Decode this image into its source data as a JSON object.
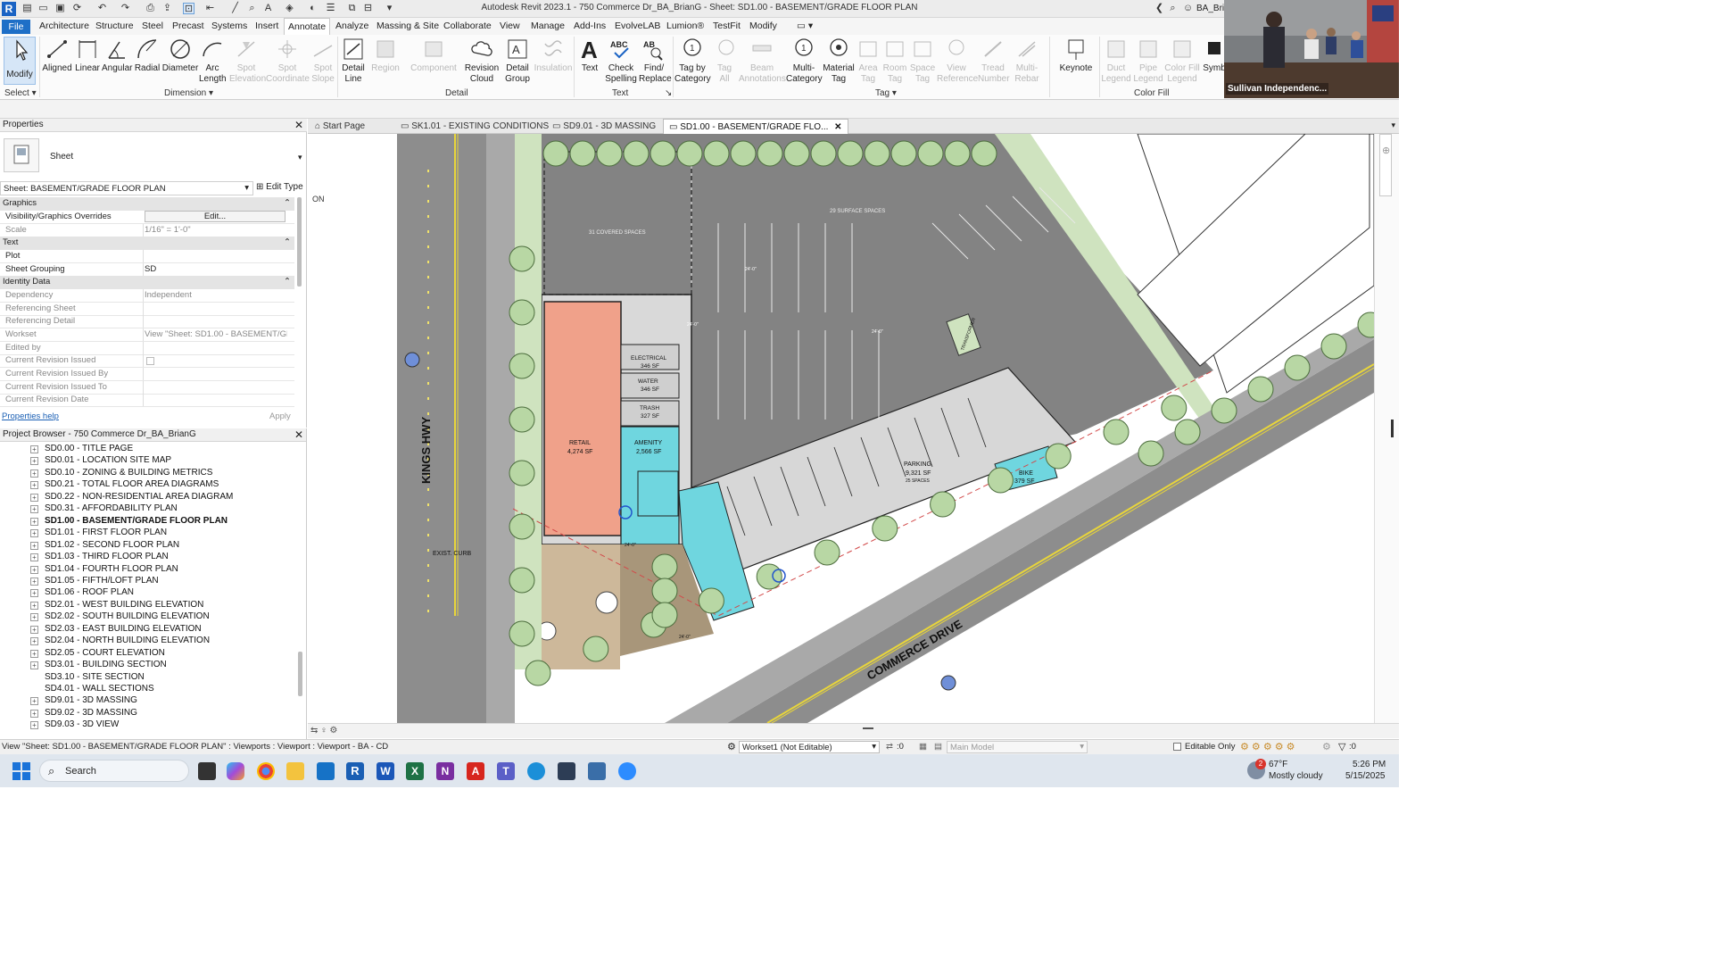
{
  "window": {
    "title": "Autodesk Revit 2023.1 - 750 Commerce Dr_BA_BrianG - Sheet: SD1.00 - BASEMENT/GRADE FLOOR PLAN",
    "user": "BA_Bria"
  },
  "menu_tabs": [
    "File",
    "Architecture",
    "Structure",
    "Steel",
    "Precast",
    "Systems",
    "Insert",
    "Annotate",
    "Analyze",
    "Massing & Site",
    "Collaborate",
    "View",
    "Manage",
    "Add-Ins",
    "EvolveLAB",
    "Lumion®",
    "TestFit",
    "Modify"
  ],
  "active_tab": "Annotate",
  "ribbon": {
    "modify": "Modify",
    "select": "Select",
    "dimension_tools": [
      "Aligned",
      "Linear",
      "Angular",
      "Radial",
      "Diameter",
      "Arc Length",
      "Spot Elevation",
      "Spot Coordinate",
      "Spot Slope"
    ],
    "dimension_group": "Dimension",
    "detail_tools": [
      "Detail Line",
      "Region",
      "Component",
      "Revision Cloud",
      "Detail Group",
      "Insulation"
    ],
    "detail_group": "Detail",
    "text_tools": [
      "Text",
      "Check Spelling",
      "Find/ Replace"
    ],
    "text_group": "Text",
    "tag_tools": [
      "Tag by Category",
      "Tag All",
      "Beam Annotations",
      "Multi- Category",
      "Material Tag",
      "Area Tag",
      "Room Tag",
      "Space Tag",
      "View Reference",
      "Tread Number",
      "Multi- Rebar"
    ],
    "tag_group": "Tag",
    "keynote": "Keynote",
    "color_fill_tools": [
      "Duct Legend",
      "Pipe Legend",
      "Color Fill Legend",
      "Symb"
    ],
    "color_fill_group": "Color Fill"
  },
  "video_caption": "Sullivan Independenc...",
  "properties": {
    "title": "Properties",
    "type_name": "Sheet",
    "selector": "Sheet: BASEMENT/GRADE FLOOR PLAN",
    "edit_type": "Edit Type",
    "categories": {
      "graphics": "Graphics",
      "text": "Text",
      "identity": "Identity Data"
    },
    "rows": [
      {
        "k": "Visibility/Graphics Overrides",
        "v": "Edit..."
      },
      {
        "k": "Scale",
        "v": "1/16\" = 1'-0\""
      },
      {
        "k": "Plot",
        "v": ""
      },
      {
        "k": "Sheet Grouping",
        "v": "SD"
      },
      {
        "k": "Dependency",
        "v": "Independent"
      },
      {
        "k": "Referencing Sheet",
        "v": ""
      },
      {
        "k": "Referencing Detail",
        "v": ""
      },
      {
        "k": "Workset",
        "v": "View \"Sheet: SD1.00 - BASEMENT/GR..."
      },
      {
        "k": "Edited by",
        "v": ""
      },
      {
        "k": "Current Revision Issued",
        "v": ""
      },
      {
        "k": "Current Revision Issued By",
        "v": ""
      },
      {
        "k": "Current Revision Issued To",
        "v": ""
      },
      {
        "k": "Current Revision Date",
        "v": ""
      }
    ],
    "help": "Properties help",
    "apply": "Apply"
  },
  "browser": {
    "title": "Project Browser - 750 Commerce Dr_BA_BrianG",
    "items": [
      "SD0.00 - TITLE PAGE",
      "SD0.01 - LOCATION SITE MAP",
      "SD0.10 - ZONING & BUILDING METRICS",
      "SD0.21 - TOTAL FLOOR AREA DIAGRAMS",
      "SD0.22 - NON-RESIDENTIAL AREA DIAGRAM",
      "SD0.31 - AFFORDABILITY PLAN",
      "SD1.00 - BASEMENT/GRADE FLOOR PLAN",
      "SD1.01 - FIRST FLOOR PLAN",
      "SD1.02 - SECOND FLOOR PLAN",
      "SD1.03 - THIRD FLOOR PLAN",
      "SD1.04 - FOURTH FLOOR PLAN",
      "SD1.05 - FIFTH/LOFT PLAN",
      "SD1.06 - ROOF PLAN",
      "SD2.01 - WEST BUILDING ELEVATION",
      "SD2.02 - SOUTH BUILDING ELEVATION",
      "SD2.03 - EAST BUILDING ELEVATION",
      "SD2.04 - NORTH BUILDING ELEVATION",
      "SD2.05 - COURT ELEVATION",
      "SD3.01 - BUILDING SECTION",
      "SD3.10 - SITE SECTION",
      "SD4.01 - WALL SECTIONS",
      "SD9.01 - 3D MASSING",
      "SD9.02 - 3D MASSING",
      "SD9.03 - 3D VIEW"
    ]
  },
  "view_tabs": [
    "Start Page",
    "SK1.01 - EXISTING CONDITIONS",
    "SD9.01 - 3D MASSING",
    "SD1.00 - BASEMENT/GRADE FLO..."
  ],
  "plan": {
    "street_west": "KINGS HWY",
    "street_south": "COMMERCE DRIVE",
    "exist_curb": "EXIST. CURB",
    "covered_spaces": "31 COVERED SPACES",
    "surface_spaces": "29 SURFACE SPACES",
    "rooms": [
      {
        "name": "RETAIL",
        "area": "4,274 SF"
      },
      {
        "name": "ELECTRICAL",
        "area": "346 SF"
      },
      {
        "name": "WATER",
        "area": "346 SF"
      },
      {
        "name": "TRASH",
        "area": "327 SF"
      },
      {
        "name": "AMENITY",
        "area": "2,566 SF"
      },
      {
        "name": "PARKING",
        "area": "9,321 SF",
        "extra": "25 SPACES"
      },
      {
        "name": "BIKE",
        "area": "379 SF"
      }
    ],
    "transformer": "TRANSFORMER",
    "side_mark": "ON",
    "dims": [
      "24'-0\"",
      "24'-0\"",
      "24'-0\"",
      "24'-0\"",
      "24'-0\""
    ]
  },
  "status": {
    "left": "View \"Sheet: SD1.00 - BASEMENT/GRADE FLOOR PLAN\" : Viewports : Viewport : Viewport - BA - CD",
    "workset": "Workset1 (Not Editable)",
    "zero": ":0",
    "model": "Main Model",
    "editable_only": "Editable Only",
    "filter_zero": ":0"
  },
  "taskbar": {
    "search": "Search",
    "weather_temp": "67°F",
    "weather_desc": "Mostly cloudy",
    "time": "5:26 PM",
    "date": "5/15/2025",
    "badge": "2"
  },
  "colors": {
    "accent": "#1e6fc7",
    "retail": "#f0a18a",
    "amenity": "#6fd6df",
    "parking": "#d3d3d3",
    "landscape": "#cfe3bf",
    "paving": "#8c8c8c",
    "plaza": "#cdb89a"
  }
}
